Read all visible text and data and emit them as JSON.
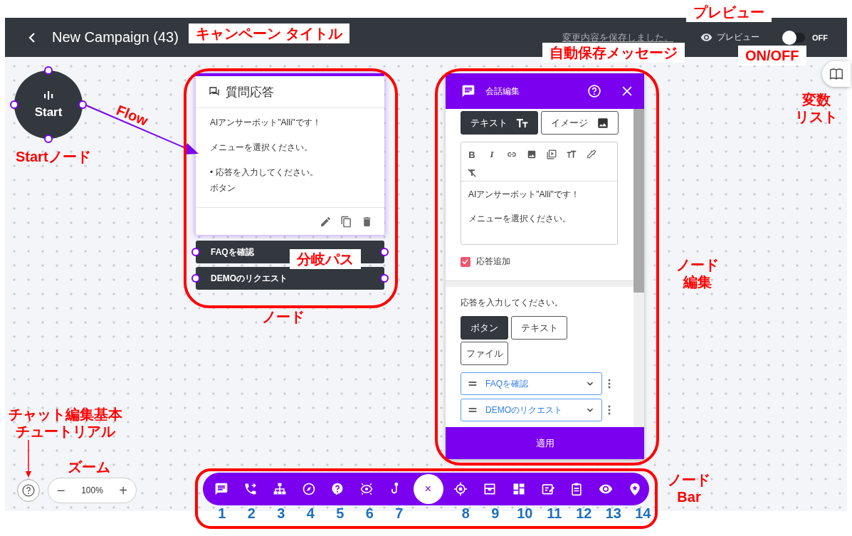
{
  "header": {
    "title": "New Campaign (43)",
    "save_message": "変更内容を保存しました。",
    "preview_label": "プレビュー",
    "toggle": {
      "on": false,
      "label": "OFF"
    }
  },
  "start_node": {
    "label": "Start"
  },
  "node": {
    "title": "質問応答",
    "paragraphs": [
      [
        "AIアンサーボット\"Alli\"です！"
      ],
      [
        "メニューを選択ください。"
      ],
      [
        "• 応答を入力してください。",
        "ボタン"
      ]
    ],
    "branches": [
      "FAQを確認",
      "DEMOのリクエスト"
    ]
  },
  "editor": {
    "title": "会話編集",
    "content_tabs": [
      {
        "label": "テキスト",
        "selected": true
      },
      {
        "label": "イメージ",
        "selected": false
      }
    ],
    "format_letters": [
      "B",
      "I"
    ],
    "text_lines": [
      "AIアンサーボット\"Alli\"です！",
      "メニューを選択ください。"
    ],
    "add_response": {
      "label": "応答追加",
      "checked": true
    },
    "response_prompt": "応答を入力してください。",
    "response_types": [
      {
        "label": "ボタン",
        "selected": true
      },
      {
        "label": "テキスト",
        "selected": false
      },
      {
        "label": "ファイル",
        "selected": false
      }
    ],
    "buttons": [
      "FAQを確認",
      "DEMOのリクエスト"
    ],
    "apply": "適用"
  },
  "zoom": {
    "out": "−",
    "value": "100%",
    "in": "+"
  },
  "node_bar": {
    "close": "×",
    "tools": [
      {
        "number": "1"
      },
      {
        "number": "2"
      },
      {
        "number": "3"
      },
      {
        "number": "4"
      },
      {
        "number": "5"
      },
      {
        "number": "6"
      },
      {
        "number": "7"
      },
      {
        "number": "8"
      },
      {
        "number": "9"
      },
      {
        "number": "10"
      },
      {
        "number": "11"
      },
      {
        "number": "12"
      },
      {
        "number": "13"
      },
      {
        "number": "14"
      }
    ]
  },
  "annotations": [
    {
      "kind": "boxed",
      "lines": [
        "キャンペーン タイトル"
      ]
    },
    {
      "kind": "boxed",
      "lines": [
        "プレビュー"
      ]
    },
    {
      "kind": "boxed",
      "lines": [
        "自動保存メッセージ"
      ]
    },
    {
      "kind": "boxed",
      "lines": [
        "ON/OFF"
      ]
    },
    {
      "kind": "plain",
      "lines": [
        "変数",
        "リスト"
      ]
    },
    {
      "kind": "plain",
      "lines": [
        "Flow"
      ]
    },
    {
      "kind": "plain",
      "lines": [
        "Startノード"
      ]
    },
    {
      "kind": "boxed",
      "lines": [
        "分岐パス"
      ]
    },
    {
      "kind": "plain",
      "lines": [
        "ノード"
      ]
    },
    {
      "kind": "plain",
      "lines": [
        "ノード",
        "編集"
      ]
    },
    {
      "kind": "plain",
      "lines": [
        "チャット編集基本",
        "チュートリアル"
      ]
    },
    {
      "kind": "plain",
      "lines": [
        "ズーム"
      ]
    },
    {
      "kind": "plain",
      "lines": [
        "ノード",
        "Bar"
      ]
    }
  ]
}
